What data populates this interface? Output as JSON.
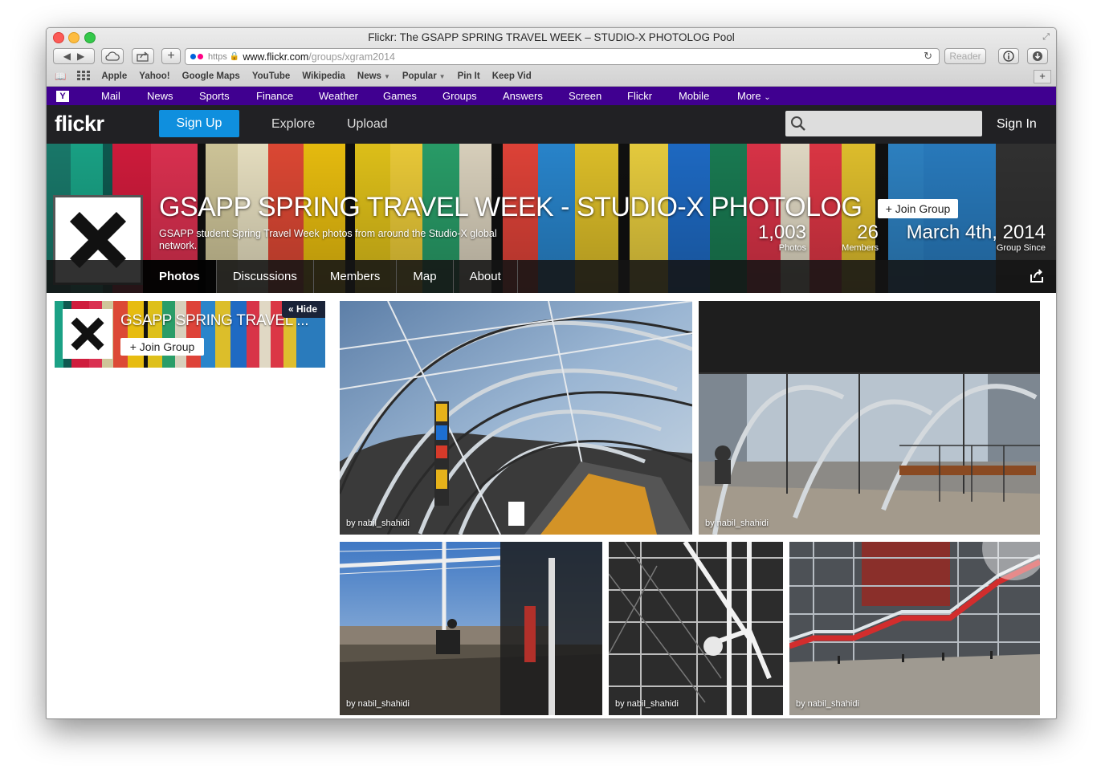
{
  "window": {
    "title": "Flickr: The GSAPP SPRING TRAVEL WEEK – STUDIO-X PHOTOLOG Pool"
  },
  "address_bar": {
    "scheme": "https",
    "host": "www.flickr.com",
    "path": "/groups/xgram2014",
    "reader_label": "Reader"
  },
  "bookmarks": [
    {
      "label": "Apple"
    },
    {
      "label": "Yahoo!"
    },
    {
      "label": "Google Maps"
    },
    {
      "label": "YouTube"
    },
    {
      "label": "Wikipedia"
    },
    {
      "label": "News"
    },
    {
      "label": "Popular"
    },
    {
      "label": "Pin It"
    },
    {
      "label": "Keep Vid"
    }
  ],
  "yahoo_bar": {
    "logo": "Y",
    "items": [
      "Mail",
      "News",
      "Sports",
      "Finance",
      "Weather",
      "Games",
      "Groups",
      "Answers",
      "Screen",
      "Flickr",
      "Mobile",
      "More"
    ]
  },
  "header": {
    "logo": "flickr",
    "signup": "Sign Up",
    "explore": "Explore",
    "upload": "Upload",
    "signin": "Sign In",
    "search_placeholder": ""
  },
  "group": {
    "title": "GSAPP SPRING TRAVEL WEEK - STUDIO-X PHOTOLOG",
    "join": "+ Join Group",
    "description": "GSAPP student Spring Travel Week photos from around the Studio-X global network.",
    "stats": [
      {
        "value": "1,003",
        "label": "Photos"
      },
      {
        "value": "26",
        "label": "Members"
      },
      {
        "value": "March 4th, 2014",
        "label": "Group Since"
      }
    ],
    "tabs": [
      "Photos",
      "Discussions",
      "Members",
      "Map",
      "About"
    ]
  },
  "side_card": {
    "title": "GSAPP SPRING TRAVEL ...",
    "join": "+ Join Group",
    "hide": "« Hide"
  },
  "photos": [
    {
      "credit": "by nabil_shahidi"
    },
    {
      "credit": "by nabil_shahidi"
    },
    {
      "credit": "by nabil_shahidi"
    },
    {
      "credit": "by nabil_shahidi"
    },
    {
      "credit": "by nabil_shahidi"
    }
  ],
  "colors": {
    "yahoo_purple": "#400090",
    "flickr_dark": "#212124",
    "signup_blue": "#0f8fde",
    "flickr_blue": "#0063dc",
    "flickr_pink": "#ff0084"
  }
}
